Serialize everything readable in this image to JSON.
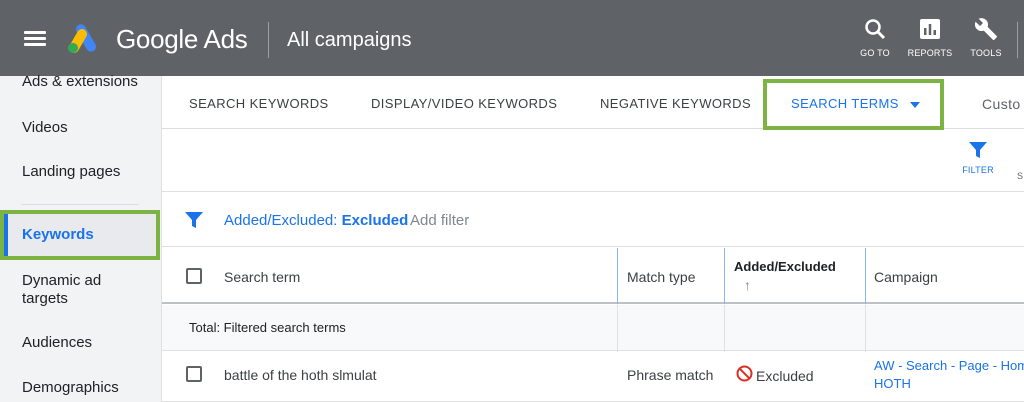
{
  "header": {
    "brand": "Google Ads",
    "page_title": "All campaigns",
    "buttons": [
      {
        "label": "GO TO",
        "icon": "search-icon"
      },
      {
        "label": "REPORTS",
        "icon": "reports-icon"
      },
      {
        "label": "TOOLS",
        "icon": "wrench-icon"
      }
    ]
  },
  "sidebar": {
    "items": [
      {
        "label": "Ads & extensions"
      },
      {
        "label": "Videos"
      },
      {
        "label": "Landing pages"
      },
      {
        "label": "Keywords"
      },
      {
        "label": "Dynamic ad targets"
      },
      {
        "label": "Audiences"
      },
      {
        "label": "Demographics"
      }
    ],
    "active": "Keywords"
  },
  "tabs": {
    "items": [
      {
        "label": "SEARCH KEYWORDS"
      },
      {
        "label": "DISPLAY/VIDEO KEYWORDS"
      },
      {
        "label": "NEGATIVE KEYWORDS"
      },
      {
        "label": "SEARCH TERMS"
      },
      {
        "label": "Custo"
      }
    ]
  },
  "toolbar": {
    "filter_label": "FILTER",
    "cut_label": "S"
  },
  "filter": {
    "field": "Added/Excluded:",
    "value": "Excluded",
    "add_filter": "Add filter"
  },
  "table": {
    "columns": [
      "Search term",
      "Match type",
      "Added/Excluded",
      "Campaign"
    ],
    "sort_indicator": "↑",
    "total_label": "Total: Filtered search terms",
    "rows": [
      {
        "search_term": "battle of the hoth slmulat",
        "match_type": "Phrase match",
        "added_excluded": "Excluded",
        "campaign_line1": "AW - Search - Page - Hom",
        "campaign_line2": "HOTH"
      }
    ]
  },
  "colors": {
    "header_bg": "#5f6368",
    "accent_blue": "#1a73e8",
    "highlight_green": "#7cb342",
    "excluded_red": "#d93025"
  }
}
